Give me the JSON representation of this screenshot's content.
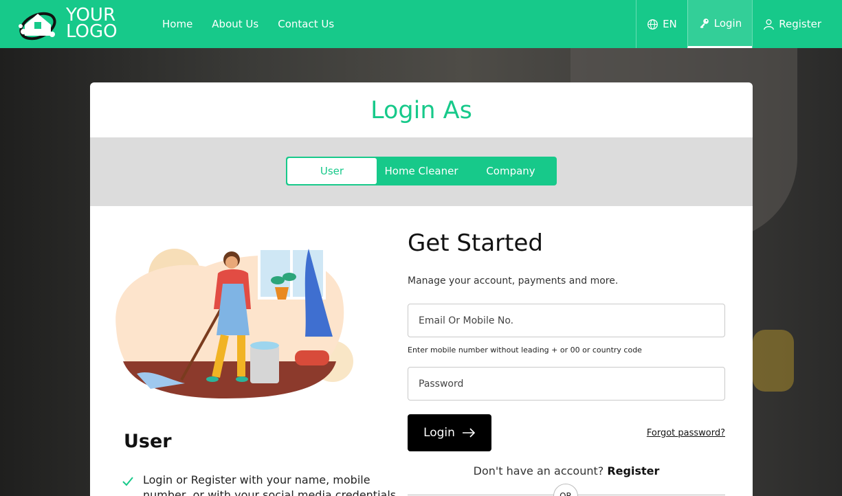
{
  "header": {
    "logo_line1": "YOUR",
    "logo_line2": "LOGO",
    "nav": [
      "Home",
      "About Us",
      "Contact Us"
    ],
    "language": "EN",
    "login": "Login",
    "register": "Register",
    "brand_color": "#17c98a"
  },
  "card": {
    "title": "Login As",
    "tabs": [
      "User",
      "Home Cleaner",
      "Company"
    ],
    "active_tab": "User",
    "section_heading": "User",
    "bullet": "Login or Register with your name, mobile number, or with your social media credentials"
  },
  "form": {
    "title": "Get Started",
    "subtitle": "Manage your account, payments and more.",
    "email_placeholder": "Email Or Mobile No.",
    "hint": "Enter mobile number without leading + or 00 or country code",
    "password_placeholder": "Password",
    "login_button": "Login",
    "forgot": "Forgot password?",
    "no_account": "Don't have an account?",
    "register_link": "Register",
    "or": "OR"
  }
}
